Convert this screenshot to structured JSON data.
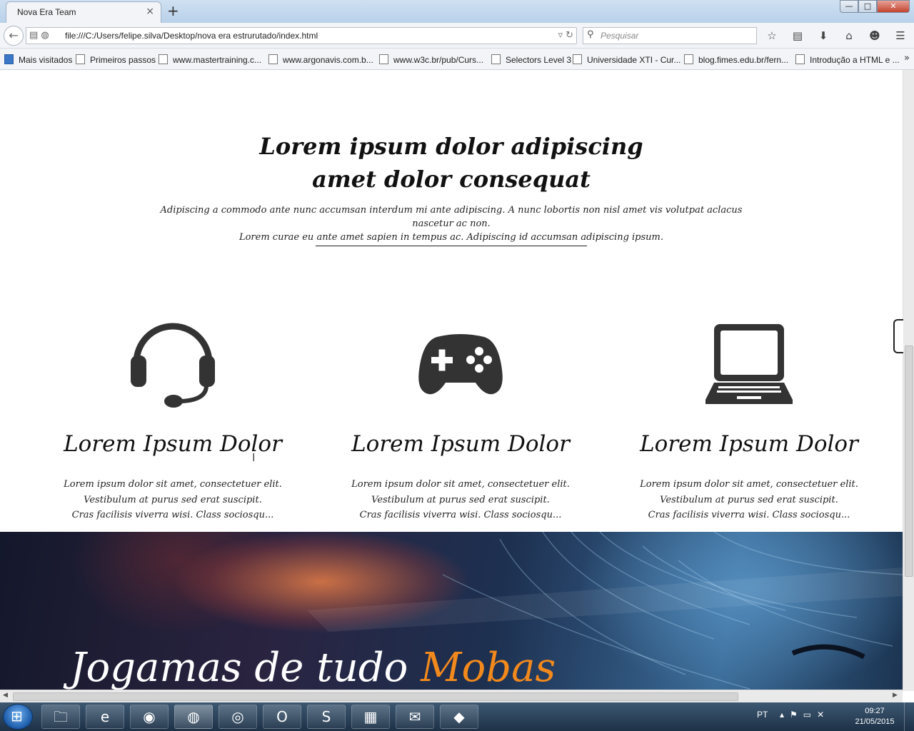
{
  "browser": {
    "tab_title": "Nova Era Team",
    "tab_close": "×",
    "new_tab": "+",
    "window_controls": {
      "minimize": "—",
      "maximize": "□",
      "close": "✕"
    },
    "url": "file:///C:/Users/felipe.silva/Desktop/nova era estrurutado/index.html",
    "search_placeholder": "Pesquisar",
    "bookmarks": [
      "Mais visitados",
      "Primeiros passos",
      "www.mastertraining.c...",
      "www.argonavis.com.b...",
      "www.w3c.br/pub/Curs...",
      "Selectors Level 3",
      "Universidade XTI - Cur...",
      "blog.fimes.edu.br/fern...",
      "Introdução a HTML e ..."
    ],
    "bookmarks_more": "»"
  },
  "page": {
    "heading_line1": "Lorem ipsum dolor adipiscing",
    "heading_line2": "amet dolor consequat",
    "intro_line1": "Adipiscing a commodo ante nunc accumsan interdum mi ante adipiscing. A nunc lobortis non nisl amet vis volutpat aclacus nascetur ac non.",
    "intro_line2": "Lorem curae eu ante amet sapien in tempus ac. Adipiscing id accumsan adipiscing ipsum.",
    "features": [
      {
        "icon": "headset-icon",
        "title": "Lorem Ipsum Dolor",
        "line1": "Lorem ipsum dolor sit amet, consectetuer elit.",
        "line2": "Vestibulum at purus sed erat suscipit.",
        "line3": "Cras facilisis viverra wisi. Class sociosqu..."
      },
      {
        "icon": "gamepad-icon",
        "title": "Lorem Ipsum Dolor",
        "line1": "Lorem ipsum dolor sit amet, consectetuer elit.",
        "line2": "Vestibulum at purus sed erat suscipit.",
        "line3": "Cras facilisis viverra wisi. Class sociosqu..."
      },
      {
        "icon": "laptop-icon",
        "title": "Lorem Ipsum Dolor",
        "line1": "Lorem ipsum dolor sit amet, consectetuer elit.",
        "line2": "Vestibulum at purus sed erat suscipit.",
        "line3": "Cras facilisis viverra wisi. Class sociosqu..."
      }
    ],
    "banner_text": "Jogamas de tudo",
    "banner_accent": "Mobas"
  },
  "taskbar": {
    "language": "PT",
    "time": "09:27",
    "date": "21/05/2015",
    "apps": [
      "file-explorer-icon",
      "internet-explorer-icon",
      "chrome-icon",
      "firefox-icon",
      "safari-icon",
      "opera-icon",
      "sublime-text-icon",
      "winrar-icon",
      "outlook-icon",
      "virtualbox-icon"
    ]
  },
  "colors": {
    "accent": "#f2891c",
    "icon": "#333333"
  }
}
